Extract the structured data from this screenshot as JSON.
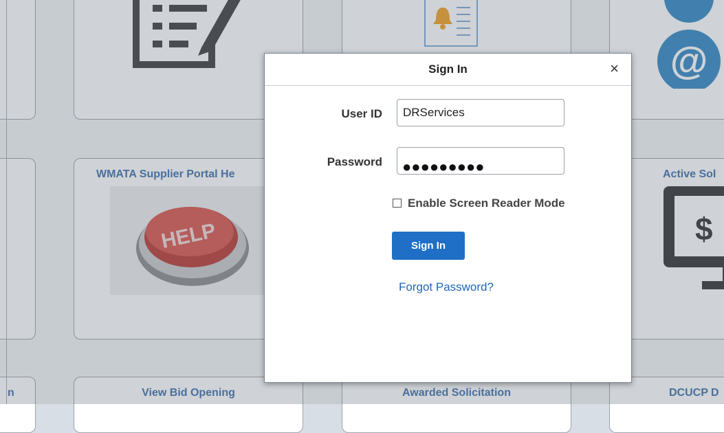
{
  "modal": {
    "title": "Sign In",
    "close_symbol": "×",
    "user_id_label": "User ID",
    "user_id_value": "DRServices",
    "password_label": "Password",
    "password_display": "●●●●●●●●●",
    "screen_reader_label": "Enable Screen Reader Mode",
    "sign_in_button": "Sign In",
    "forgot_password_link": "Forgot Password?"
  },
  "tiles": {
    "supplier_portal_help": "WMATA Supplier Portal He",
    "active_solicitations": "Active Sol",
    "view_bid_opening": "View Bid Opening",
    "awarded_solicitation": "Awarded Solicitation",
    "dcucp": "DCUCP D",
    "left_partial": "n",
    "help_button_text": "HELP"
  },
  "icons": {
    "top_left_tile": "document-edit-icon",
    "top_middle_tile": "notification-list-icon",
    "top_right_tile": "email-at-icon",
    "help_tile": "help-button-icon",
    "active_solicitations_tile": "monitor-dollar-icon"
  },
  "colors": {
    "primary_button": "#1f6fc6",
    "link": "#1d66b8",
    "tile_title": "#3b6ea8"
  }
}
